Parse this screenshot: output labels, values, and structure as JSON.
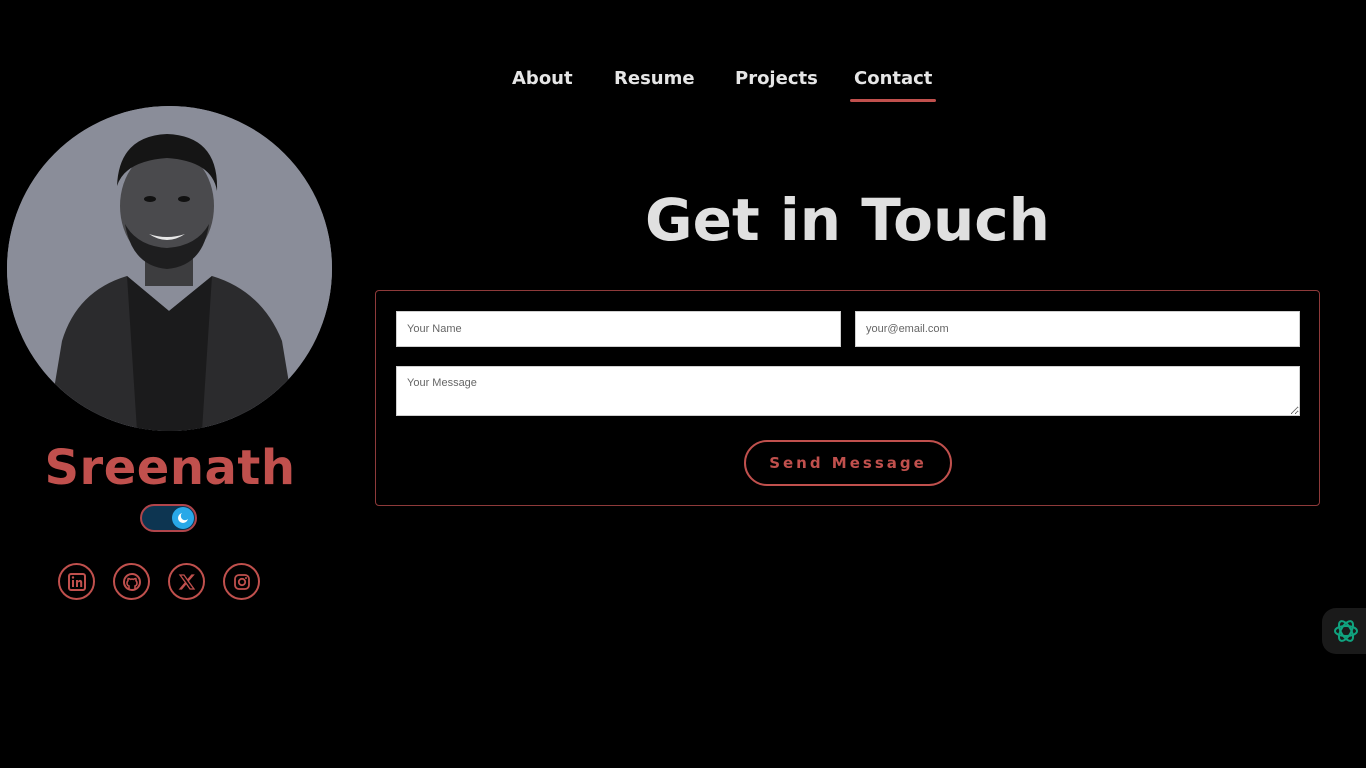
{
  "nav": {
    "items": [
      {
        "label": "About"
      },
      {
        "label": "Resume"
      },
      {
        "label": "Projects"
      },
      {
        "label": "Contact"
      }
    ],
    "active": "Contact"
  },
  "profile": {
    "name": "Sreenath",
    "avatar_icon": "profile-photo",
    "theme_toggle_state": "dark",
    "socials": [
      {
        "icon": "linkedin-icon"
      },
      {
        "icon": "github-icon"
      },
      {
        "icon": "x-icon"
      },
      {
        "icon": "instagram-icon"
      }
    ]
  },
  "contact": {
    "title": "Get in Touch",
    "name_placeholder": "Your Name",
    "email_placeholder": "your@email.com",
    "message_placeholder": "Your Message",
    "send_label": "Send Message"
  },
  "colors": {
    "background": "#000000",
    "accent": "#c0504d",
    "text": "#e6e6e6",
    "toggle_track": "#0d3551",
    "toggle_knob": "#29a8e8",
    "assistant_icon": "#10a37f"
  }
}
